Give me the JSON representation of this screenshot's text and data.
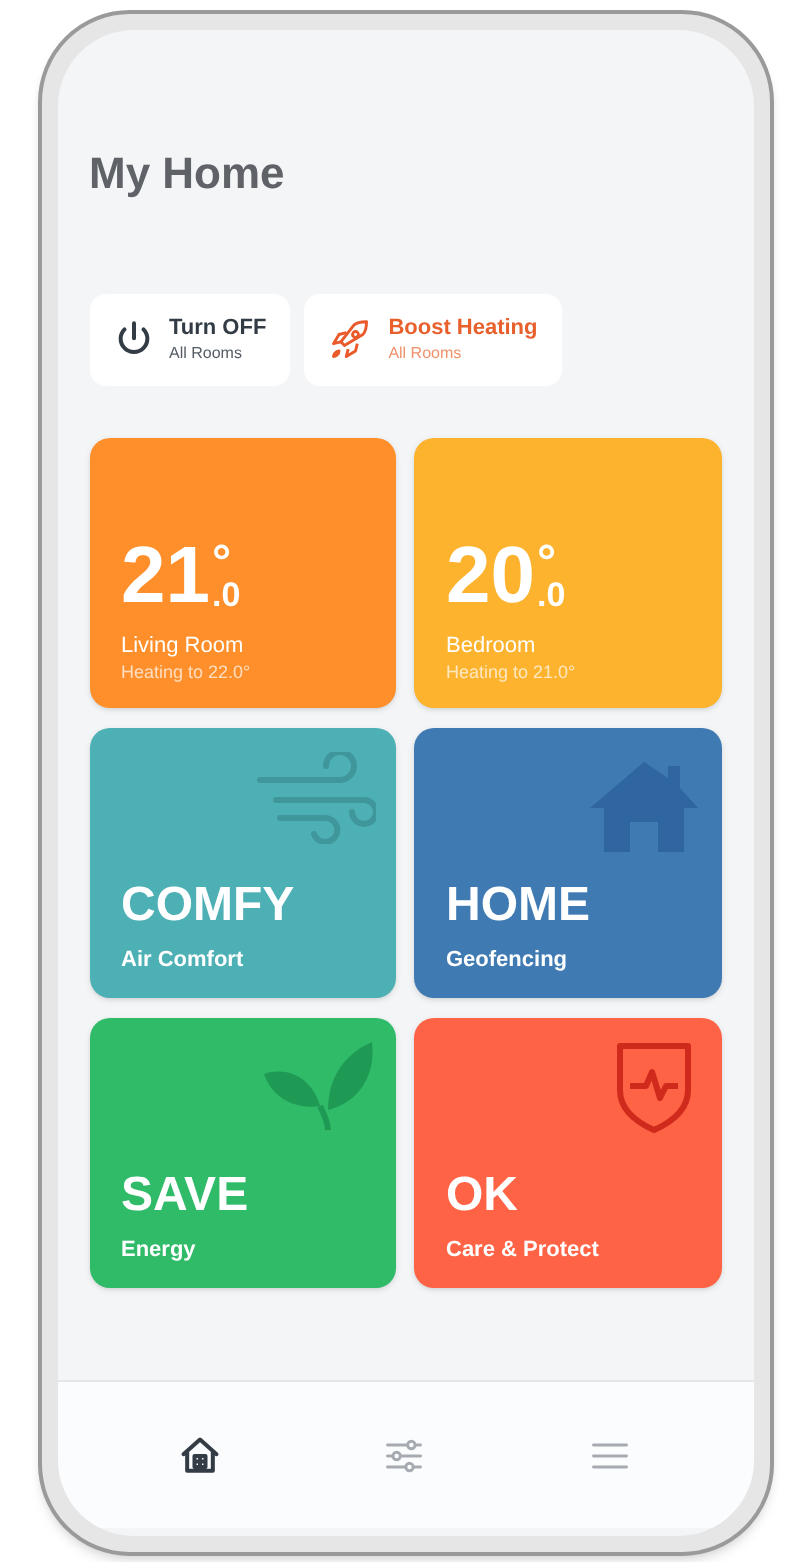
{
  "title": "My Home",
  "actions": [
    {
      "label": "Turn OFF",
      "sublabel": "All Rooms",
      "kind": "power"
    },
    {
      "label": "Boost Heating",
      "sublabel": "All Rooms",
      "kind": "boost"
    }
  ],
  "tiles": [
    {
      "kind": "temperature",
      "whole": "21",
      "unit": "°",
      "decimal": ".0",
      "name": "Living Room",
      "status": "Heating to 22.0°",
      "color": "#ff8f2a"
    },
    {
      "kind": "temperature",
      "whole": "20",
      "unit": "°",
      "decimal": ".0",
      "name": "Bedroom",
      "status": "Heating to 21.0°",
      "color": "#fdb32e"
    },
    {
      "kind": "mode",
      "label": "COMFY",
      "sublabel": "Air Comfort",
      "color": "#4db0b5"
    },
    {
      "kind": "mode",
      "label": "HOME",
      "sublabel": "Geofencing",
      "color": "#3f7ab3"
    },
    {
      "kind": "mode",
      "label": "SAVE",
      "sublabel": "Energy",
      "color": "#2fbb68"
    },
    {
      "kind": "mode",
      "label": "OK",
      "sublabel": "Care & Protect",
      "color": "#fe6345"
    }
  ],
  "nav": [
    {
      "selected": true
    },
    {
      "selected": false
    },
    {
      "selected": false
    }
  ]
}
